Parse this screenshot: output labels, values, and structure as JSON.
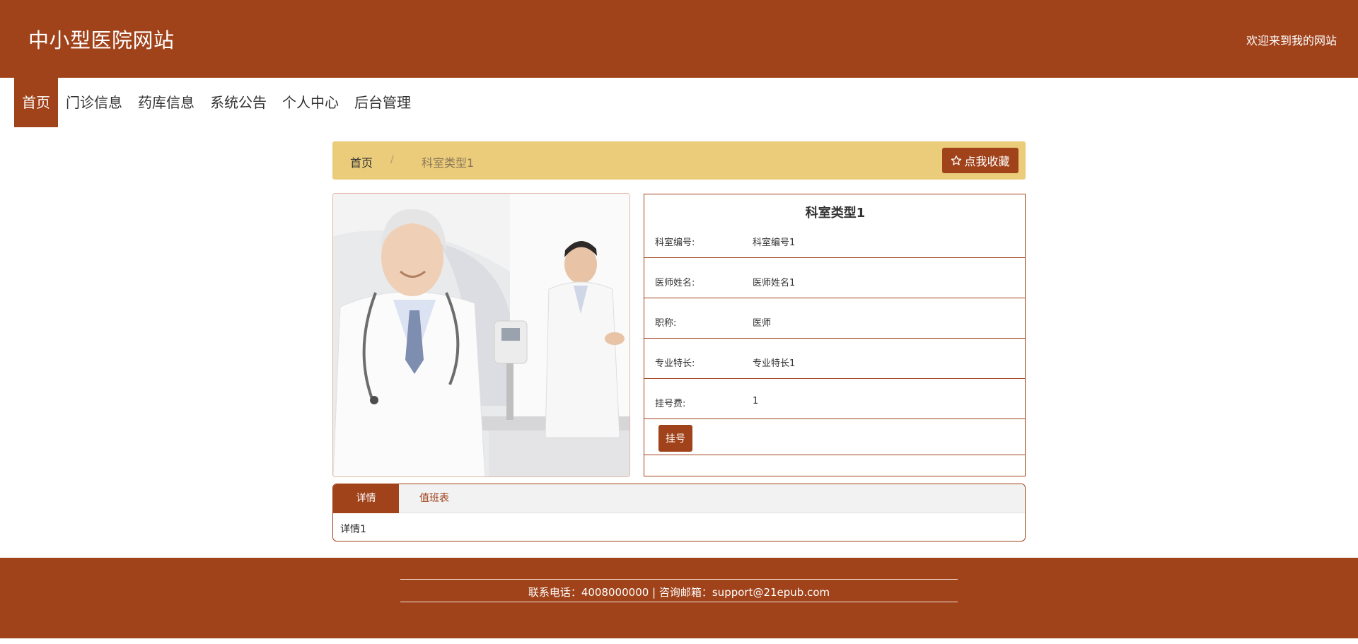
{
  "header": {
    "site_title": "中小型医院网站",
    "welcome": "欢迎来到我的网站"
  },
  "nav": {
    "items": [
      {
        "label": "首页",
        "active": true
      },
      {
        "label": "门诊信息"
      },
      {
        "label": "药库信息"
      },
      {
        "label": "系统公告"
      },
      {
        "label": "个人中心"
      },
      {
        "label": "后台管理"
      }
    ]
  },
  "breadcrumb": {
    "home": "首页",
    "separator": "/",
    "current": "科室类型1"
  },
  "favorite_button": {
    "icon": "star-icon",
    "label": "点我收藏"
  },
  "detail": {
    "title": "科室类型1",
    "rows": [
      {
        "label": "科室编号:",
        "value": "科室编号1"
      },
      {
        "label": "医师姓名:",
        "value": "医师姓名1"
      },
      {
        "label": "职称:",
        "value": "医师"
      },
      {
        "label": "专业特长:",
        "value": "专业特长1"
      },
      {
        "label": "挂号费:",
        "value": "1"
      }
    ],
    "register_button": "挂号"
  },
  "tabs": {
    "items": [
      "详情",
      "值班表"
    ],
    "active_content": "详情1"
  },
  "footer": {
    "contact": "联系电话：4008000000 | 咨询邮箱：support@21epub.com"
  },
  "colors": {
    "brand": "#a0421a",
    "breadcrumb_bg": "#eacc7a"
  }
}
